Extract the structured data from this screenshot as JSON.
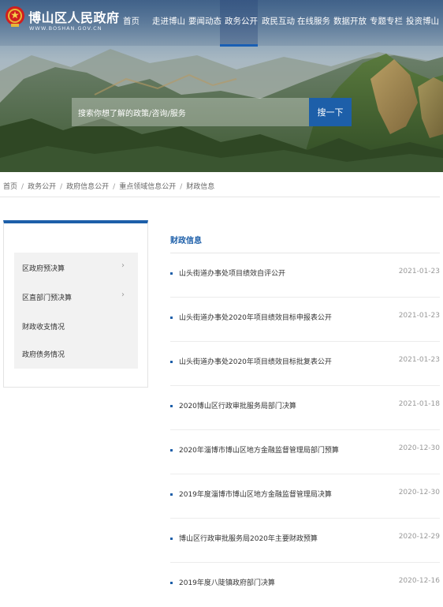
{
  "header": {
    "site_title": "博山区人民政府",
    "site_url": "WWW.BOSHAN.GOV.CN",
    "nav": [
      "首页",
      "走进博山",
      "要闻动态",
      "政务公开",
      "政民互动",
      "在线服务",
      "数据开放",
      "专题专栏",
      "投资博山"
    ],
    "active_nav": "政务公开"
  },
  "search": {
    "placeholder": "搜索你想了解的政策/咨询/服务",
    "button_label": "搜一下"
  },
  "breadcrumb": [
    "首页",
    "政务公开",
    "政府信息公开",
    "重点领域信息公开",
    "财政信息"
  ],
  "sidebar": {
    "items": [
      {
        "label": "区政府预决算",
        "has_children": true
      },
      {
        "label": "区直部门预决算",
        "has_children": true
      },
      {
        "label": "财政收支情况",
        "has_children": false
      },
      {
        "label": "政府债务情况",
        "has_children": false
      }
    ]
  },
  "main": {
    "section_title": "财政信息",
    "rows": [
      {
        "title": "山头街道办事处项目绩效自评公开",
        "date": "2021-01-23"
      },
      {
        "title": "山头街道办事处2020年项目绩效目标申报表公开",
        "date": "2021-01-23"
      },
      {
        "title": "山头街道办事处2020年项目绩效目标批复表公开",
        "date": "2021-01-23"
      },
      {
        "title": "2020博山区行政审批服务局部门决算",
        "date": "2021-01-18"
      },
      {
        "title": "2020年淄博市博山区地方金融监督管理局部门预算",
        "date": "2020-12-30"
      },
      {
        "title": "2019年度淄博市博山区地方金融监督管理局决算",
        "date": "2020-12-30"
      },
      {
        "title": "博山区行政审批服务局2020年主要财政预算",
        "date": "2020-12-29"
      },
      {
        "title": "2019年度八陡镇政府部门决算",
        "date": "2020-12-16"
      }
    ]
  },
  "colors": {
    "accent": "#1d5fa9",
    "text": "#333333",
    "muted": "#999999"
  }
}
